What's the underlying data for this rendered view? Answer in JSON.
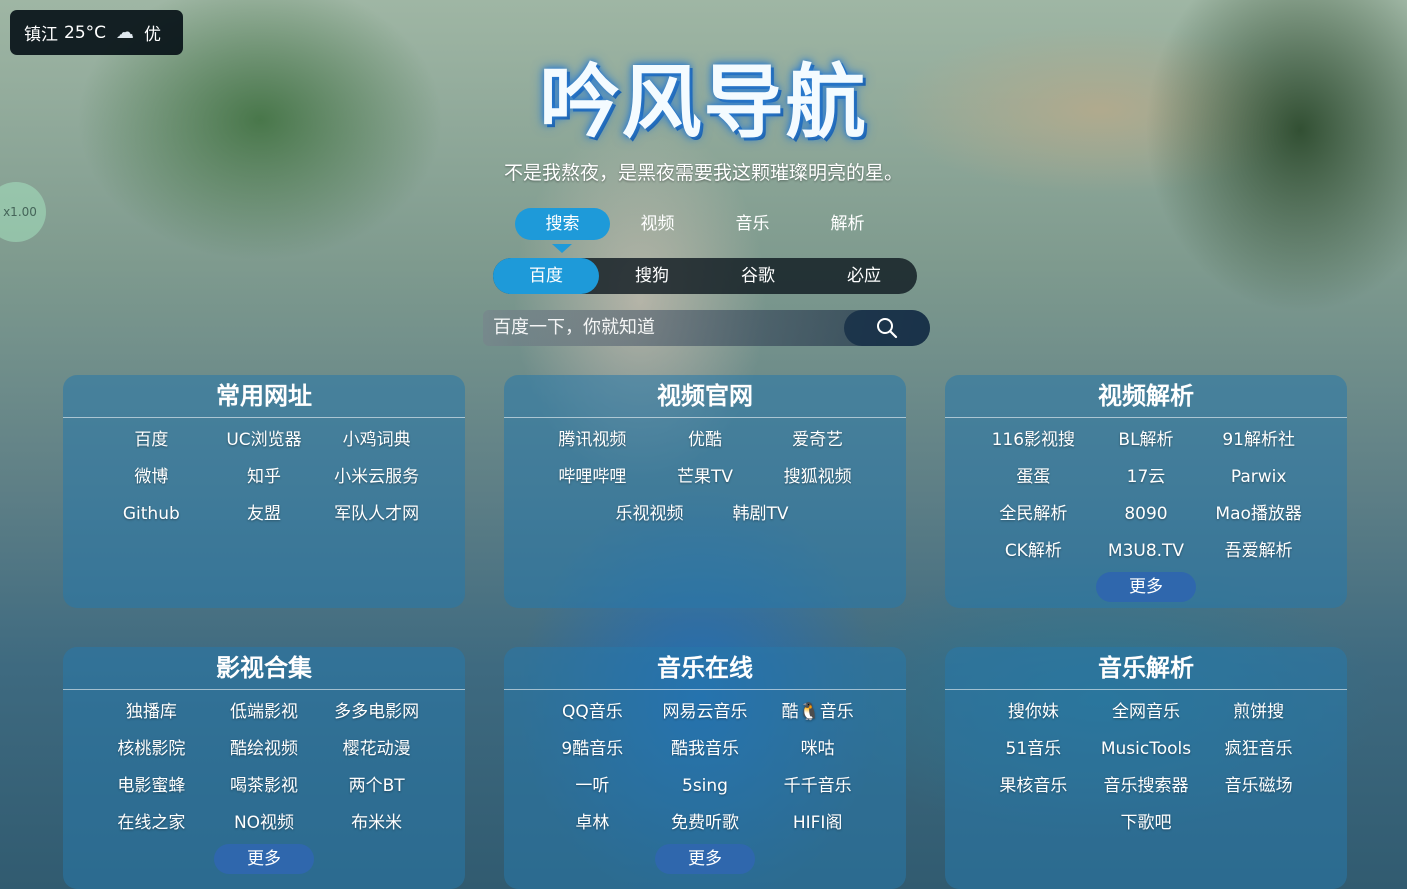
{
  "weather": {
    "city": "镇江",
    "temp": "25°C",
    "quality": "优"
  },
  "speed_label": "x1.00",
  "title": "吟风导航",
  "subtitle": "不是我熬夜，是黑夜需要我这颗璀璨明亮的星。",
  "tabs": [
    "搜索",
    "视频",
    "音乐",
    "解析"
  ],
  "engines": [
    "百度",
    "搜狗",
    "谷歌",
    "必应"
  ],
  "search": {
    "placeholder": "百度一下，你就知道"
  },
  "more_label": "更多",
  "cards": [
    {
      "title": "常用网址",
      "links": [
        "百度",
        "UC浏览器",
        "小鸡词典",
        "微博",
        "知乎",
        "小米云服务",
        "Github",
        "友盟",
        "军队人才网"
      ]
    },
    {
      "title": "视频官网",
      "links": [
        "腾讯视频",
        "优酷",
        "爱奇艺",
        "哔哩哔哩",
        "芒果TV",
        "搜狐视频",
        "乐视视频",
        "韩剧TV"
      ]
    },
    {
      "title": "视频解析",
      "links": [
        "116影视搜",
        "BL解析",
        "91解析社",
        "蛋蛋",
        "17云",
        "Parwix",
        "全民解析",
        "8090",
        "Mao播放器",
        "CK解析",
        "M3U8.TV",
        "吾爱解析"
      ]
    },
    {
      "title": "影视合集",
      "links": [
        "独播库",
        "低端影视",
        "多多电影网",
        "核桃影院",
        "酷绘视频",
        "樱花动漫",
        "电影蜜蜂",
        "喝茶影视",
        "两个BT",
        "在线之家",
        "NO视频",
        "布米米"
      ]
    },
    {
      "title": "音乐在线",
      "links": [
        "QQ音乐",
        "网易云音乐",
        "酷🐧音乐",
        "9酷音乐",
        "酷我音乐",
        "咪咕",
        "一听",
        "5sing",
        "千千音乐",
        "卓林",
        "免费听歌",
        "HIFI阁"
      ]
    },
    {
      "title": "音乐解析",
      "links": [
        "搜你妹",
        "全网音乐",
        "煎饼搜",
        "51音乐",
        "MusicTools",
        "疯狂音乐",
        "果核音乐",
        "音乐搜索器",
        "音乐磁场",
        "下歌吧"
      ]
    }
  ]
}
